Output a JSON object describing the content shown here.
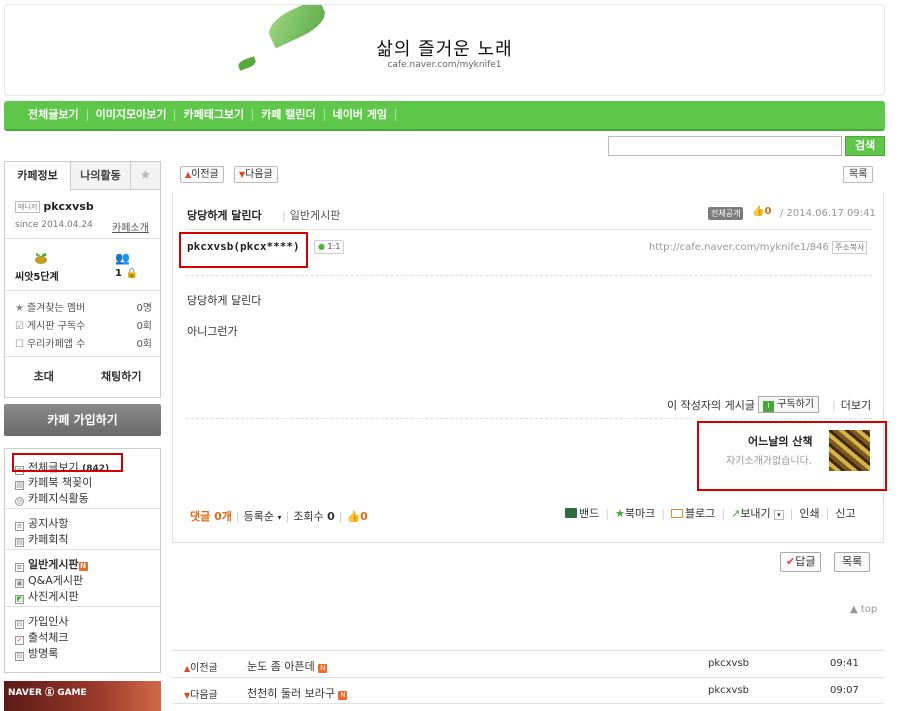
{
  "header": {
    "title": "삶의 즐거운 노래",
    "url": "cafe.naver.com/myknife1"
  },
  "gnb": {
    "items": [
      "전체글보기",
      "이미지모아보기",
      "카페태그보기",
      "카페 캘린더",
      "네이버 게임"
    ]
  },
  "search": {
    "button": "검색",
    "placeholder": ""
  },
  "sidebar": {
    "tabs": [
      "카페정보",
      "나의활동",
      "★"
    ],
    "manager_badge": "매니저",
    "manager": "pkcxvsb",
    "since": "since 2014.04.24",
    "cafe_intro": "카페소개",
    "grade": "씨앗5단계",
    "members": "1",
    "stats": [
      {
        "icon": "★",
        "label": "즐겨찾는 멤버",
        "value": "0명"
      },
      {
        "icon": "☑",
        "label": "게시판 구독수",
        "value": "0회"
      },
      {
        "icon": "☐",
        "label": "우리카페앱 수",
        "value": "0회"
      }
    ],
    "invite": "초대",
    "chat": "채팅하기",
    "join": "카페 가입하기",
    "menu": {
      "all_posts": "전체글보기",
      "all_count": "(842)",
      "book": "카페북 책꽂이",
      "knowledge": "카페지식활동",
      "notice": "공지사항",
      "rules": "카페회칙",
      "general": "일반게시판",
      "qa": "Q&A게시판",
      "photo": "사진게시판",
      "greeting": "가입인사",
      "attendance": "출석체크",
      "guestbook": "방명록",
      "new_badge": "N"
    },
    "naver_game": "NAVER ⓖ GAME"
  },
  "toolbar": {
    "prev": "이전글",
    "next": "다음글",
    "list": "목록"
  },
  "post": {
    "title": "당당하게 달린다",
    "board": "일반게시판",
    "public_badge": "전체공개",
    "likes": "0",
    "date": "/ 2014.06.17 09:41",
    "author": "pkcxvsb(pkcx****)",
    "chat_badge": "1:1",
    "url": "http://cafe.naver.com/myknife1/846",
    "copy_address": "주소복사",
    "body": [
      "당당하게 달린다",
      "아니그런가"
    ],
    "writer_posts": "이 작성자의 게시글",
    "subscribe": "구독하기",
    "more": "더보기",
    "profile_name": "어느날의 산책",
    "profile_desc": "자기소개가없습니다."
  },
  "comments": {
    "label": "댓글",
    "count": "0개",
    "sort": "등록순",
    "views_label": "조회수",
    "views": "0",
    "likes": "0"
  },
  "share": {
    "band": "밴드",
    "bookmark": "북마크",
    "blog": "블로그",
    "send": "보내기",
    "print": "인쇄",
    "report": "신고"
  },
  "actions": {
    "reply": "답글",
    "list": "목록",
    "top": "▲ top"
  },
  "nav_posts": [
    {
      "dir": "이전글",
      "title": "눈도 좀 아픈데",
      "writer": "pkcxvsb",
      "time": "09:41"
    },
    {
      "dir": "다음글",
      "title": "천천히 둘러 보라구",
      "writer": "pkcxvsb",
      "time": "09:07"
    }
  ],
  "colors": {
    "accent_green": "#5fc74a",
    "highlight_red": "#d40000",
    "orange": "#e26a14"
  }
}
